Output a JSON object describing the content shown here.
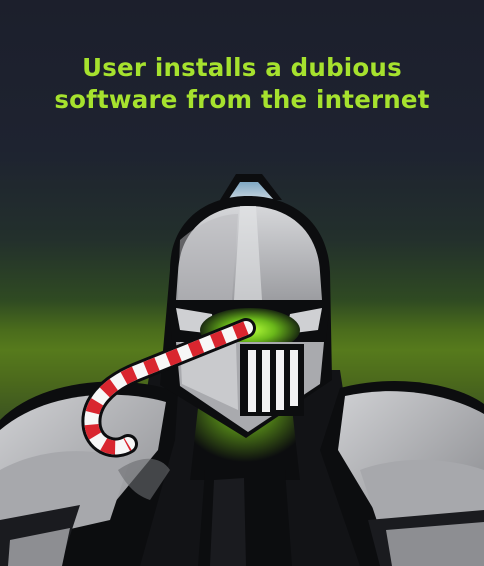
{
  "headline": {
    "line1": "User installs a dubious",
    "line2": "software from the internet"
  },
  "illustration": {
    "subject": "knight-in-armor-with-candy-cane",
    "colors": {
      "background_top": "#1c1f2c",
      "background_glow": "#567a1c",
      "text_accent": "#a6e22e",
      "armor_light": "#c8c9cc",
      "armor_dark": "#8d8e92",
      "outline": "#0c0d0f",
      "visor_glow": "#8be01a",
      "plume_tip": "#7fa8c4",
      "candy_red": "#d9262f",
      "candy_white": "#f7f7f7"
    }
  }
}
